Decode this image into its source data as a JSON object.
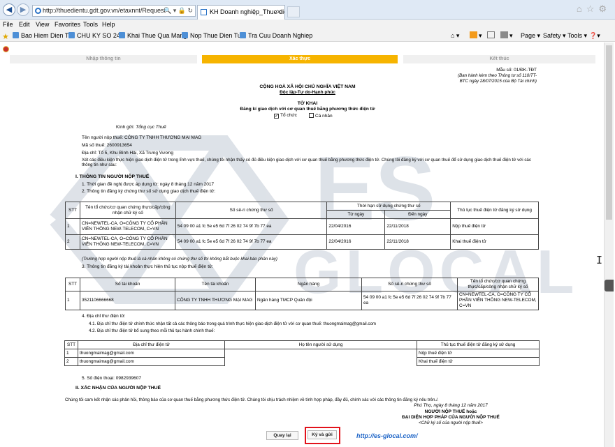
{
  "browser": {
    "address": "http://thuedientu.gdt.gov.vn/etaxnnt/Request",
    "tab_title": "KH Doanh nghiệp_Thue die...",
    "menu": [
      "File",
      "Edit",
      "View",
      "Favorites",
      "Tools",
      "Help"
    ],
    "favorites": [
      "Bao Hiem Dien Tu",
      "CHU KY SO 24H",
      "Khai Thue Qua Mang",
      "Nop Thue Dien Tu",
      "Tra Cuu Doanh Nghiep"
    ],
    "tools": {
      "page": "Page ▾",
      "safety": "Safety ▾",
      "tools": "Tools ▾",
      "help": "❓▾"
    }
  },
  "steps": [
    {
      "label": "Nhập thông tin",
      "active": false
    },
    {
      "label": "Xác thực",
      "active": true
    },
    {
      "label": "Kết thúc",
      "active": false
    }
  ],
  "form": {
    "mau_so": "Mẫu số: 01/ĐK-TĐT",
    "ban_hanh": "(Ban hành kèm theo Thông tư số 110/TT-",
    "ban_hanh2": "BTC ngày 28/07/2015 của Bộ Tài chính)",
    "quoc_hieu": "CỘNG HOÀ XÃ HỘI CHỦ NGHĨA VIỆT NAM",
    "tieu_ngu": "Độc lập-Tự do-Hạnh phúc",
    "to_khai": "TỜ KHAI",
    "dang_ky": "Đăng kí giao dịch với cơ quan thuế bằng phương thức điện tử",
    "to_chuc": "Tổ chức",
    "ca_nhan": "Cá nhân",
    "kinh_gui_label": "Kính gửi:",
    "kinh_gui": "Tổng cục Thuế",
    "ten_nnt": "Tên người nộp thuế: CÔNG TY TNHH THƯƠNG MẠI MAG",
    "mst": "Mã số thuế: 2600913654",
    "dia_chi": "Địa chỉ: Tổ 5, Khu Bình Hải, Xã Trưng Vương",
    "xet_cac_1": "Xét các điều kiện thực hiện giao dịch điện tử trong lĩnh vực thuế, chúng tôi nhận thấy có đủ điều kiện giao dịch với cơ quan thuế bằng phương thức điện tử. Chúng tôi đăng ký với cơ quan thuế để sử dụng giao dịch thuế điện tử với các",
    "xet_cac_2": "thông tin như sau:",
    "sec1": "I. THÔNG TIN NGƯỜI NỘP THUẾ",
    "sec1_1": "1. Thời gian đề nghị được áp dụng từ: ngày 8 tháng 12 năm 2017",
    "sec1_2": "2. Thông tin đăng ký chứng thư số sử dụng giao dịch thuế điện tử:",
    "note": "(Trường hợp người nộp thuế là cá nhân không có chứng thư số thì không bắt buộc khai báo phần này)",
    "sec1_3": "3. Thông tin đăng ký tài khoản thực hiện thủ tục nộp thuế điện tử:",
    "sec1_4": "4. Địa chỉ thư điện tử:",
    "sec1_4_1": "4.1. Địa chỉ thư điện tử chính thức nhận tất cả các thông báo trong quá trình thực hiện giao dịch điện tử với cơ quan thuế: thuongmaimag@gmail.com",
    "sec1_4_2": "4.2. Địa chỉ thư điện tử bổ sung theo mỗi thủ tục hành chính thuế:",
    "sec1_5": "5. Số điện thoại: 0982939607",
    "sec2": "II. XÁC NHẬN CỦA NGƯỜI NỘP THUẾ",
    "cam_ket": "Chúng tôi cam kết nhận các phản hồi, thông báo của cơ quan thuế bằng phương thức điện tử. Chúng tôi chịu trách nhiệm về tính hợp pháp, đầy đủ, chính xác với các thông tin đăng ký nêu trên./.",
    "place_date": "Phú Thọ, ngày 8 tháng 12 năm 2017",
    "sign_1": "NGƯỜI NỘP THUẾ hoặc",
    "sign_2": "ĐẠI DIỆN HỢP PHÁP CỦA NGƯỜI NỘP THUẾ",
    "sign_3": "<Chữ ký số của người nộp thuế>"
  },
  "cert_table": {
    "headers": [
      "STT",
      "Tên tổ chức/cơ quan chứng thực/cấp/công nhận chữ ký số",
      "Số sê-ri chứng thư số",
      "Thời hạn sử dụng chứng thư số",
      "Từ ngày",
      "Đến ngày",
      "Thủ tục thuế điện tử đăng ký sử dụng"
    ],
    "rows": [
      {
        "stt": "1",
        "org": "CN=NEWTEL-CA, O=CÔNG TY CỔ PHẦN VIỄN THÔNG NEW-TELECOM, C=VN",
        "serial": "54 09 00 a1 fc 5e e5 6d 7f 26 02 74 9f 7b 77 ea",
        "from": "22/04/2016",
        "to": "22/11/2018",
        "proc": "Nộp thuế điện tử"
      },
      {
        "stt": "2",
        "org": "CN=NEWTEL-CA, O=CÔNG TY CỔ PHẦN VIỄN THÔNG NEW-TELECOM, C=VN",
        "serial": "54 09 00 a1 fc 5e e5 6d 7f 26 02 74 9f 7b 77 ea",
        "from": "22/04/2016",
        "to": "22/11/2018",
        "proc": "Khai thuế điện tử"
      }
    ]
  },
  "account_table": {
    "headers": [
      "STT",
      "Số tài khoản",
      "Tên tài khoản",
      "Ngân hàng",
      "Số sê-ri chứng thư số",
      "Tên tổ chức/cơ quan chứng thực/cấp/công nhận chữ ký số"
    ],
    "rows": [
      {
        "stt": "1",
        "account": "3521106666668",
        "name": "CÔNG TY TNHH THƯƠNG MẠI MAG",
        "bank": "Ngân hàng TMCP Quân đội",
        "serial": "54 09 00 a1 fc 5e e5 6d 7f 26 02 74 9f 7b 77 ea",
        "org": "CN=NEWTEL-CA, O=CÔNG TY CỔ PHẦN VIỄN THÔNG NEW-TELECOM, C=VN"
      }
    ]
  },
  "email_table": {
    "headers": [
      "STT",
      "Địa chỉ thư điện tử",
      "Họ tên người sử dụng",
      "Thủ tục thuế điện tử đăng ký sử dụng"
    ],
    "rows": [
      {
        "stt": "1",
        "email": "thuongmaimag@gmail.com",
        "user": "",
        "proc": "Nộp thuế điện tử"
      },
      {
        "stt": "2",
        "email": "thuongmaimag@gmail.com",
        "user": "",
        "proc": "Khai thuế điện tử"
      }
    ]
  },
  "buttons": {
    "back": "Quay lại",
    "sign_send": "Ký và gửi"
  },
  "watermark": {
    "brand": "ES",
    "sub": "GLOCAL",
    "link": "http://es-glocal.com/"
  },
  "colors": {
    "active_step": "#f6b400",
    "highlight": "#e2121b",
    "link": "#1b63c6",
    "watermark": "#c3cbd6"
  },
  "icons": [
    "back-icon",
    "forward-icon",
    "refresh-icon",
    "home-icon",
    "star-icon",
    "gear-icon",
    "rss-icon",
    "mail-icon",
    "print-icon",
    "ie-icon"
  ]
}
